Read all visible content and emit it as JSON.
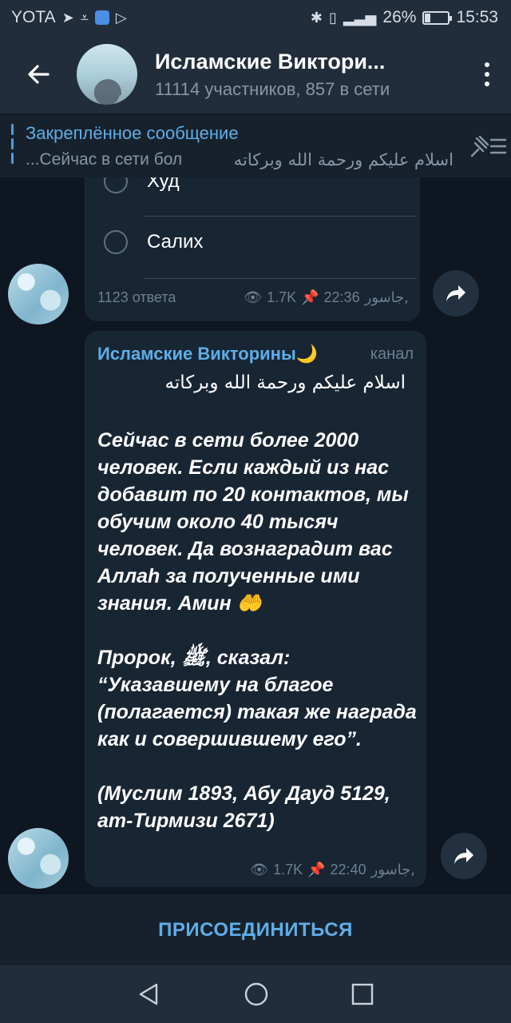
{
  "status_bar": {
    "carrier": "YOTA",
    "battery": "26%",
    "battery_level": 0.26,
    "time": "15:53"
  },
  "header": {
    "title": "Исламские Виктори...",
    "subtitle": "11114 участников, 857 в сети"
  },
  "pinned": {
    "title": "Закреплённое сообщение",
    "preview_left": "...Сейчас в сети бол",
    "preview_arabic": "اسلام عليكم ورحمة الله وبركاته"
  },
  "poll": {
    "options": [
      "Худ",
      "Салих"
    ],
    "answers": "1123 ответа",
    "views": "1.7K",
    "time": "22:36",
    "author": "جاسور,"
  },
  "message": {
    "author": "Исламские Викторины🌙",
    "badge": "канал",
    "arabic": "اسلام عليكم ورحمة الله وبركاته",
    "paragraphs": [
      "Сейчас в сети более 2000 человек. Если каждый из нас добавит по 20 контактов, мы обучим около 40 тысяч человек. Да вознаградит вас Аллаh за полученные ими знания. Амин 🤲",
      "Пророк, ﷺ, сказал: “Указавшему на благое (полагается) такая же награда как и совершившему его”.",
      "(Муслим 1893, Абу Дауд 5129, ат-Тирмизи 2671)"
    ],
    "views": "1.7K",
    "time": "22:40",
    "signer": "جاسور,"
  },
  "join": {
    "label": "ПРИСОЕДИНИТЬСЯ"
  },
  "colors": {
    "accent": "#5eaee9",
    "header_bg": "#212d3b",
    "chat_bg": "#0e1621",
    "bubble_bg": "#182533"
  }
}
